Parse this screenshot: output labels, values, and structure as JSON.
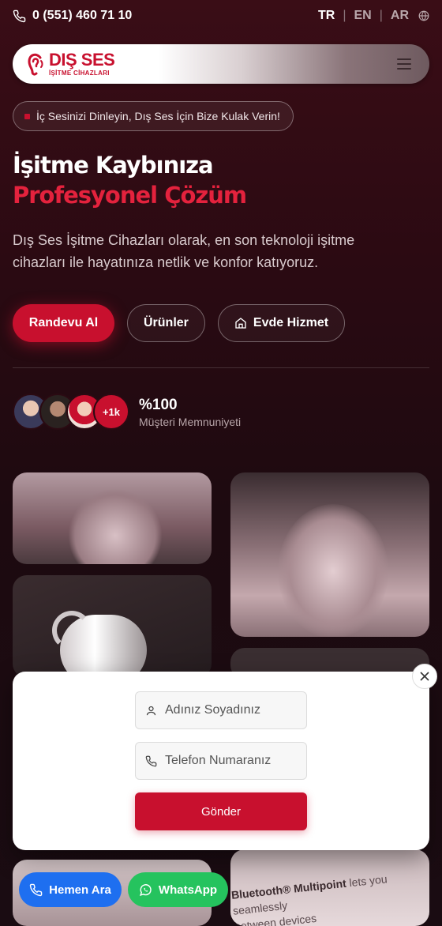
{
  "topbar": {
    "phone": "0 (551) 460 71 10",
    "languages": [
      "TR",
      "EN",
      "AR"
    ],
    "active_language": "TR",
    "separator": "|"
  },
  "brand": {
    "name": "DIŞ SES",
    "tagline": "İŞİTME CİHAZLARI",
    "color": "#c8102e"
  },
  "hero": {
    "badge": "İç Sesinizi Dinleyin, Dış Ses İçin Bize Kulak Verin!",
    "title_line1": "İşitme Kaybınıza",
    "title_line2": "Profesyonel Çözüm",
    "description": "Dış Ses İşitme Cihazları olarak, en son teknoloji işitme cihazları ile hayatınıza netlik ve konfor katıyoruz.",
    "buttons": {
      "appointment": "Randevu Al",
      "products": "Ürünler",
      "home_service": "Evde Hizmet"
    }
  },
  "stats": {
    "avatars_more": "+1k",
    "value": "%100",
    "label": "Müşteri Memnuniyeti"
  },
  "gallery": {
    "tile_text_brand": "Bluetooth® Multipoint",
    "tile_text_rest": " lets you seamlessly",
    "tile_text_line2": "between devices"
  },
  "form": {
    "name_placeholder": "Adınız Soyadınız",
    "phone_placeholder": "Telefon Numaranız",
    "submit": "Gönder"
  },
  "floating": {
    "call": "Hemen Ara",
    "whatsapp": "WhatsApp",
    "call_color": "#1e6ff0",
    "whatsapp_color": "#25c35e"
  }
}
